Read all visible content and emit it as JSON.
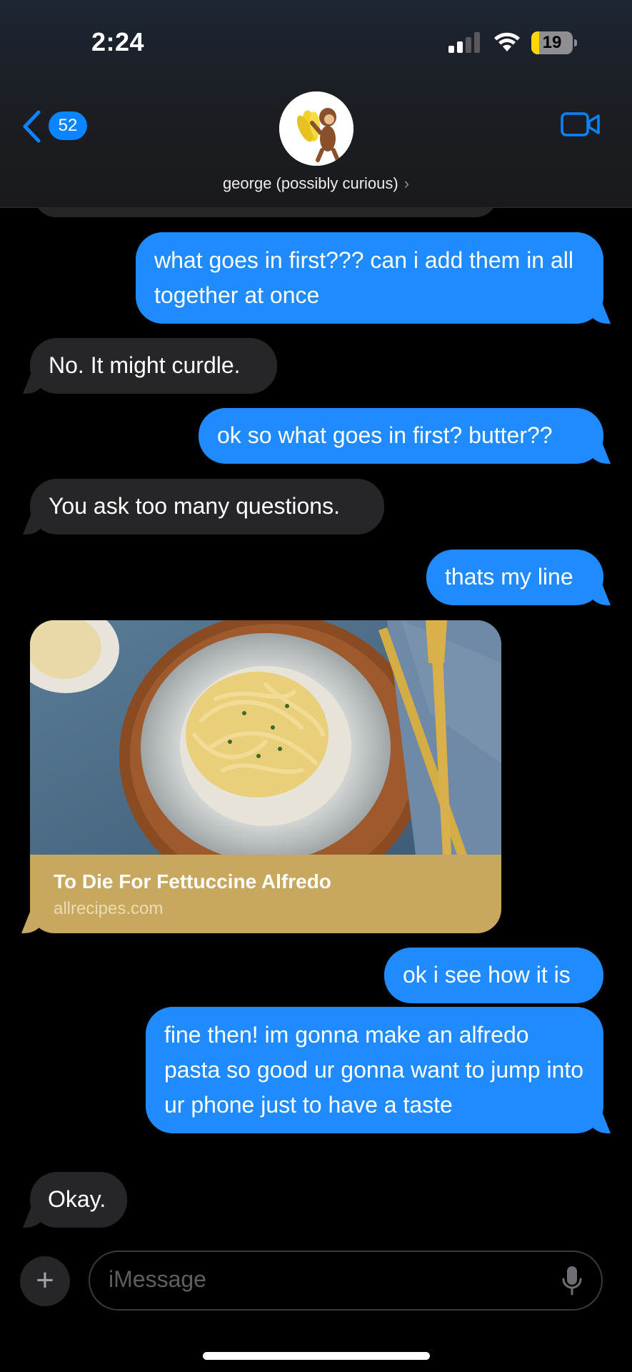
{
  "status_bar": {
    "time": "2:24",
    "battery": "19",
    "battery_level": 0.19
  },
  "header": {
    "back_badge": "52",
    "contact_name": "george (possibly curious)",
    "chevron": "›"
  },
  "messages": [
    {
      "sender": "me",
      "text": "what goes in first??? can i add them in all together at once"
    },
    {
      "sender": "them",
      "text": "No. It might curdle."
    },
    {
      "sender": "me",
      "text": "ok so what goes in first? butter??"
    },
    {
      "sender": "them",
      "text": "You ask too many questions."
    },
    {
      "sender": "me",
      "text": "thats my line"
    },
    {
      "sender": "them",
      "type": "link",
      "title": "To Die For Fettuccine Alfredo",
      "domain": "allrecipes.com"
    },
    {
      "sender": "me",
      "text": "ok i see how it is"
    },
    {
      "sender": "me",
      "text": "fine then! im gonna make an alfredo pasta so good ur gonna want to jump into ur phone just to have a taste"
    },
    {
      "sender": "them",
      "text": "Okay."
    }
  ],
  "composer": {
    "placeholder": "iMessage",
    "plus": "+"
  },
  "colors": {
    "outgoing": "#1f8bff",
    "incoming": "#262628",
    "link_footer": "#c8a75e",
    "accent": "#0a84ff"
  },
  "icons": [
    "signal-icon",
    "wifi-icon",
    "battery-icon",
    "back-chevron-icon",
    "video-call-icon",
    "plus-icon",
    "microphone-icon"
  ]
}
